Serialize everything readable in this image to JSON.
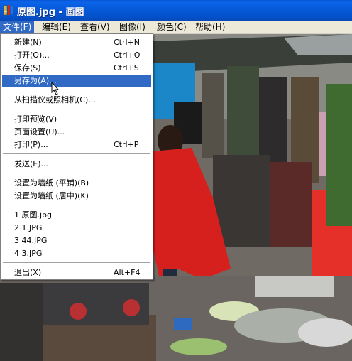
{
  "window": {
    "title": "原图.jpg - 画图"
  },
  "menubar": {
    "items": [
      "文件(F)",
      "编辑(E)",
      "查看(V)",
      "图像(I)",
      "颜色(C)",
      "帮助(H)"
    ]
  },
  "file_menu": {
    "items": [
      {
        "label": "新建(N)",
        "shortcut": "Ctrl+N"
      },
      {
        "label": "打开(O)...",
        "shortcut": "Ctrl+O"
      },
      {
        "label": "保存(S)",
        "shortcut": "Ctrl+S"
      },
      {
        "label": "另存为(A)...",
        "shortcut": ""
      },
      {
        "label": "从扫描仪或照相机(C)...",
        "shortcut": ""
      },
      {
        "label": "打印预览(V)",
        "shortcut": ""
      },
      {
        "label": "页面设置(U)...",
        "shortcut": ""
      },
      {
        "label": "打印(P)...",
        "shortcut": "Ctrl+P"
      },
      {
        "label": "发送(E)...",
        "shortcut": ""
      },
      {
        "label": "设置为墙纸 (平铺)(B)",
        "shortcut": ""
      },
      {
        "label": "设置为墙纸 (居中)(K)",
        "shortcut": ""
      },
      {
        "label": "1 原图.jpg",
        "shortcut": ""
      },
      {
        "label": "2 1.JPG",
        "shortcut": ""
      },
      {
        "label": "3 44.JPG",
        "shortcut": ""
      },
      {
        "label": "4 3.JPG",
        "shortcut": ""
      },
      {
        "label": "退出(X)",
        "shortcut": "Alt+F4"
      }
    ],
    "highlighted_index": 3
  },
  "colors": {
    "highlight": "#316ac5",
    "titlebar": "#0558d6",
    "menubar": "#ece9d8"
  }
}
